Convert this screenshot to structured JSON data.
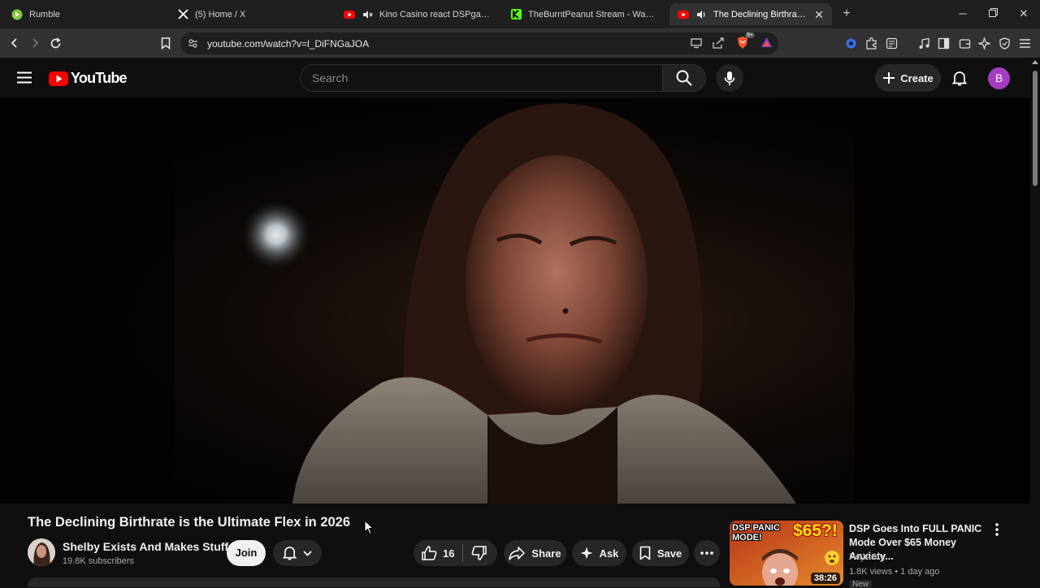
{
  "browser": {
    "tabs": [
      {
        "label": "Rumble",
        "icon": "rumble-icon",
        "active": false
      },
      {
        "label": "(5) Home / X",
        "icon": "x-icon",
        "active": false
      },
      {
        "label": "Kino Casino react DSPgamings W",
        "icon": "youtube-icon",
        "active": false
      },
      {
        "label": "TheBurntPeanut Stream - Watch Live",
        "icon": "kick-icon",
        "active": false
      },
      {
        "label": "The Declining Birthrate is the",
        "icon": "youtube-icon",
        "active": true
      }
    ],
    "url": "youtube.com/watch?v=l_DiFNGaJOA",
    "extension_badge": "9+"
  },
  "youtube": {
    "logo_text": "YouTube",
    "search_placeholder": "Search",
    "create_label": "Create",
    "avatar_letter": "B"
  },
  "video": {
    "title": "The Declining Birthrate is the Ultimate Flex in 2026",
    "channel_name": "Shelby Exists And Makes Stuff",
    "subscribers": "19.8K subscribers",
    "join_label": "Join",
    "like_count": "16",
    "share_label": "Share",
    "ask_label": "Ask",
    "save_label": "Save"
  },
  "recommendation": {
    "title": "DSP Goes Into FULL PANIC Mode Over $65 Money Anxiety...",
    "channel": "HeyArVy",
    "meta": "1.8K views • 1 day ago",
    "badge": "New",
    "duration": "38:26",
    "thumb_text_left": "DSP PANIC MODE!",
    "thumb_text_right": "$65?!"
  },
  "colors": {
    "youtube_red": "#ff0000",
    "avatar_purple": "#a53cc2",
    "background": "#0f0f0f"
  }
}
